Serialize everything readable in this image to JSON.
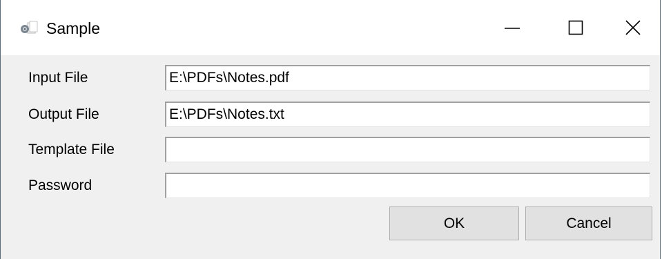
{
  "window": {
    "title": "Sample",
    "icons": {
      "app": "app-icon",
      "minimize": "minimize-icon",
      "maximize": "maximize-icon",
      "close": "close-icon"
    }
  },
  "form": {
    "fields": [
      {
        "label": "Input File",
        "value": "E:\\PDFs\\Notes.pdf"
      },
      {
        "label": "Output File",
        "value": "E:\\PDFs\\Notes.txt"
      },
      {
        "label": "Template File",
        "value": ""
      },
      {
        "label": "Password",
        "value": ""
      }
    ]
  },
  "buttons": {
    "ok_label": "OK",
    "cancel_label": "Cancel"
  },
  "colors": {
    "dialog_background": "#f0f0f0",
    "titlebar_background": "#ffffff",
    "button_face": "#e1e1e1",
    "button_border": "#adadad"
  }
}
